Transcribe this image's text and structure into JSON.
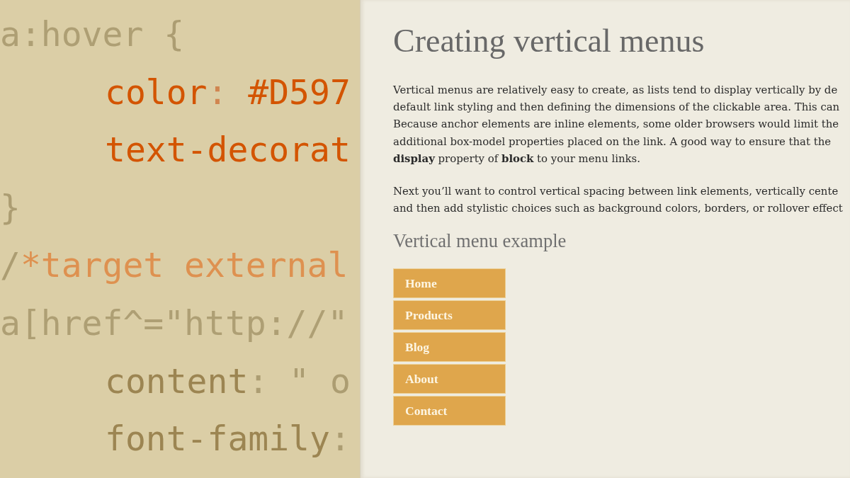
{
  "code_editor": {
    "lines": [
      {
        "kind": "selector",
        "highlighted": false,
        "tokens": [
          {
            "kind": "selector",
            "text": "a:hover"
          },
          {
            "kind": "punct",
            "text": " {"
          }
        ]
      },
      {
        "kind": "declaration",
        "highlighted": true,
        "tokens": [
          {
            "kind": "property",
            "text": "color"
          },
          {
            "kind": "punct",
            "text": ":"
          },
          {
            "kind": "value",
            "text": " #D597"
          }
        ]
      },
      {
        "kind": "declaration",
        "highlighted": true,
        "tokens": [
          {
            "kind": "property",
            "text": "text-decorat"
          }
        ]
      },
      {
        "kind": "brace",
        "highlighted": false,
        "tokens": [
          {
            "kind": "punct",
            "text": "}"
          }
        ]
      },
      {
        "kind": "comment",
        "highlighted": false,
        "tokens": [
          {
            "kind": "punct",
            "text": "/"
          },
          {
            "kind": "comment",
            "text": "*target external"
          }
        ]
      },
      {
        "kind": "selector",
        "highlighted": false,
        "tokens": [
          {
            "kind": "selector",
            "text": "a[href^=\"http://\""
          }
        ]
      },
      {
        "kind": "declaration",
        "highlighted": false,
        "tokens": [
          {
            "kind": "property",
            "text": "content"
          },
          {
            "kind": "punct",
            "text": ":"
          },
          {
            "kind": "string",
            "text": " \" o"
          }
        ]
      },
      {
        "kind": "declaration",
        "highlighted": false,
        "tokens": [
          {
            "kind": "property",
            "text": "font-family"
          },
          {
            "kind": "punct",
            "text": ":"
          }
        ]
      }
    ]
  },
  "page": {
    "heading": "Creating vertical menus",
    "paragraphs": [
      {
        "lines": [
          "Vertical menus are relatively easy to create, as lists tend to display vertically by de",
          "default link styling and then defining the dimensions of the clickable area. This can",
          "Because anchor elements are inline elements, some older browsers would limit the",
          "additional box-model properties placed on the link. A good way to ensure that the",
          "**display** property of **block** to your menu links."
        ]
      },
      {
        "lines": [
          "Next you’ll want to control vertical spacing between link elements, vertically cente",
          "and then add stylistic choices such as background colors, borders, or rollover effect"
        ]
      }
    ],
    "subheading": "Vertical menu example",
    "menu_items": [
      "Home",
      "Products",
      "Blog",
      "About",
      "Contact"
    ]
  }
}
